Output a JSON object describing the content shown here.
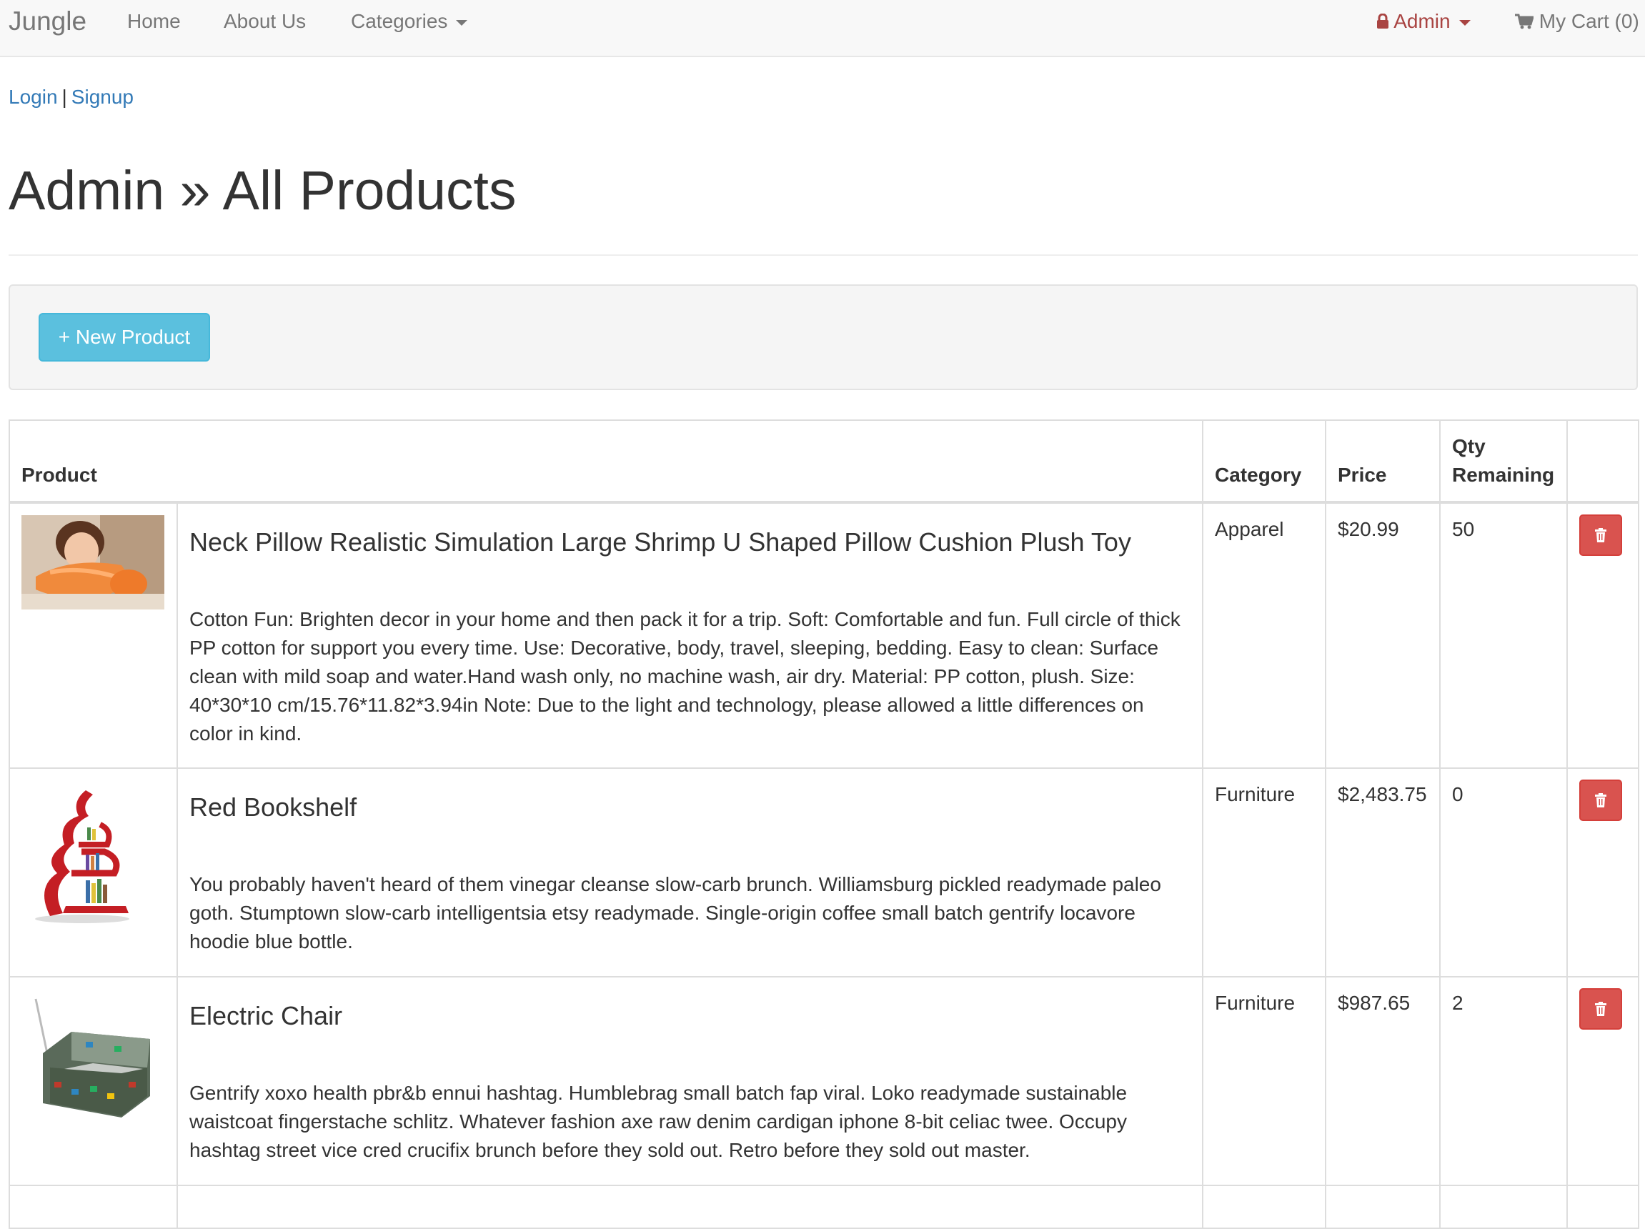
{
  "navbar": {
    "brand": "Jungle",
    "home": "Home",
    "about": "About Us",
    "categories": "Categories",
    "admin": "Admin",
    "cart": "My Cart (0)"
  },
  "auth": {
    "login": "Login",
    "separator": "|",
    "signup": "Signup"
  },
  "page": {
    "title": "Admin » All Products",
    "new_product_label": "+ New Product"
  },
  "table": {
    "headers": {
      "product": "Product",
      "category": "Category",
      "price": "Price",
      "qty_line1": "Qty",
      "qty_line2": "Remaining"
    },
    "rows": [
      {
        "name": "Neck Pillow Realistic Simulation Large Shrimp U Shaped Pillow Cushion Plush Toy",
        "description": "Cotton Fun: Brighten decor in your home and then pack it for a trip. Soft: Comfortable and fun. Full circle of thick PP cotton for support you every time. Use: Decorative, body, travel, sleeping, bedding. Easy to clean: Surface clean with mild soap and water.Hand wash only, no machine wash, air dry. Material: PP cotton, plush. Size: 40*30*10 cm/15.76*11.82*3.94in Note: Due to the light and technology, please allowed a little differences on color in kind.",
        "category": "Apparel",
        "price": "$20.99",
        "qty": "50"
      },
      {
        "name": "Red Bookshelf",
        "description": "You probably haven't heard of them vinegar cleanse slow-carb brunch. Williamsburg pickled readymade paleo goth. Stumptown slow-carb intelligentsia etsy readymade. Single-origin coffee small batch gentrify locavore hoodie blue bottle.",
        "category": "Furniture",
        "price": "$2,483.75",
        "qty": "0"
      },
      {
        "name": "Electric Chair",
        "description": "Gentrify xoxo health pbr&b ennui hashtag. Humblebrag small batch fap viral. Loko readymade sustainable waistcoat fingerstache schlitz. Whatever fashion axe raw denim cardigan iphone 8-bit celiac twee. Occupy hashtag street vice cred crucifix brunch before they sold out. Retro before they sold out master.",
        "category": "Furniture",
        "price": "$987.65",
        "qty": "2"
      }
    ]
  },
  "colors": {
    "link": "#337ab7",
    "admin": "#a94442",
    "info_button": "#5bc0de",
    "danger_button": "#d9534f",
    "navbar_bg": "#f8f8f8"
  },
  "icons": {
    "admin": "lock-icon",
    "cart": "shopping-cart-icon",
    "delete": "trash-icon",
    "dropdown": "caret-down-icon"
  }
}
